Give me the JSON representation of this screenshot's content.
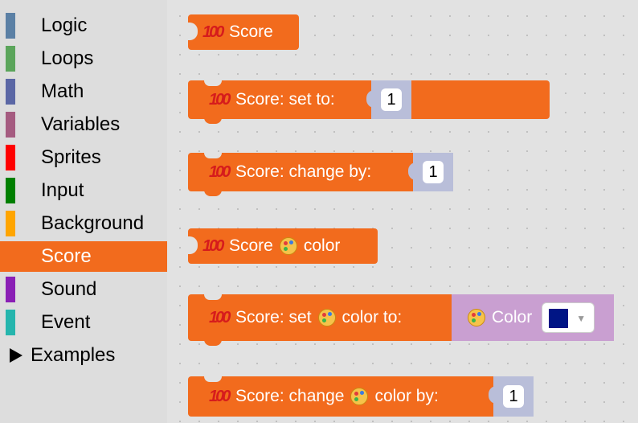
{
  "colors": {
    "score_block": "#f26b1d",
    "math_socket": "#b9bed9",
    "color_socket": "#c99fd1",
    "color_value": "#001585"
  },
  "toolbox": {
    "categories": [
      {
        "label": "Logic",
        "color": "#5b80a5",
        "selected": false
      },
      {
        "label": "Loops",
        "color": "#5ba55b",
        "selected": false
      },
      {
        "label": "Math",
        "color": "#5b67a5",
        "selected": false
      },
      {
        "label": "Variables",
        "color": "#a55b80",
        "selected": false
      },
      {
        "label": "Sprites",
        "color": "#ff0000",
        "selected": false
      },
      {
        "label": "Input",
        "color": "#007f00",
        "selected": false
      },
      {
        "label": "Background",
        "color": "#ffa500",
        "selected": false
      },
      {
        "label": "Score",
        "color": "#f26b1d",
        "selected": true
      },
      {
        "label": "Sound",
        "color": "#8a1fb5",
        "selected": false
      },
      {
        "label": "Event",
        "color": "#25b5ad",
        "selected": false
      }
    ],
    "examples_label": "Examples"
  },
  "flyout": {
    "icon_hundred": "hundred-points-icon",
    "icon_palette": "palette-icon",
    "blocks": {
      "score_reporter": {
        "text": "Score"
      },
      "score_set": {
        "text": "Score: set to:",
        "value": "1"
      },
      "score_change": {
        "text": "Score: change by:",
        "value": "1"
      },
      "score_color_reporter": {
        "prefix": "Score",
        "suffix": "color"
      },
      "score_set_color": {
        "prefix": "Score: set",
        "suffix": "color to:",
        "socket_label": "Color"
      },
      "score_change_color": {
        "prefix": "Score: change",
        "suffix": "color by:",
        "value": "1"
      }
    }
  }
}
